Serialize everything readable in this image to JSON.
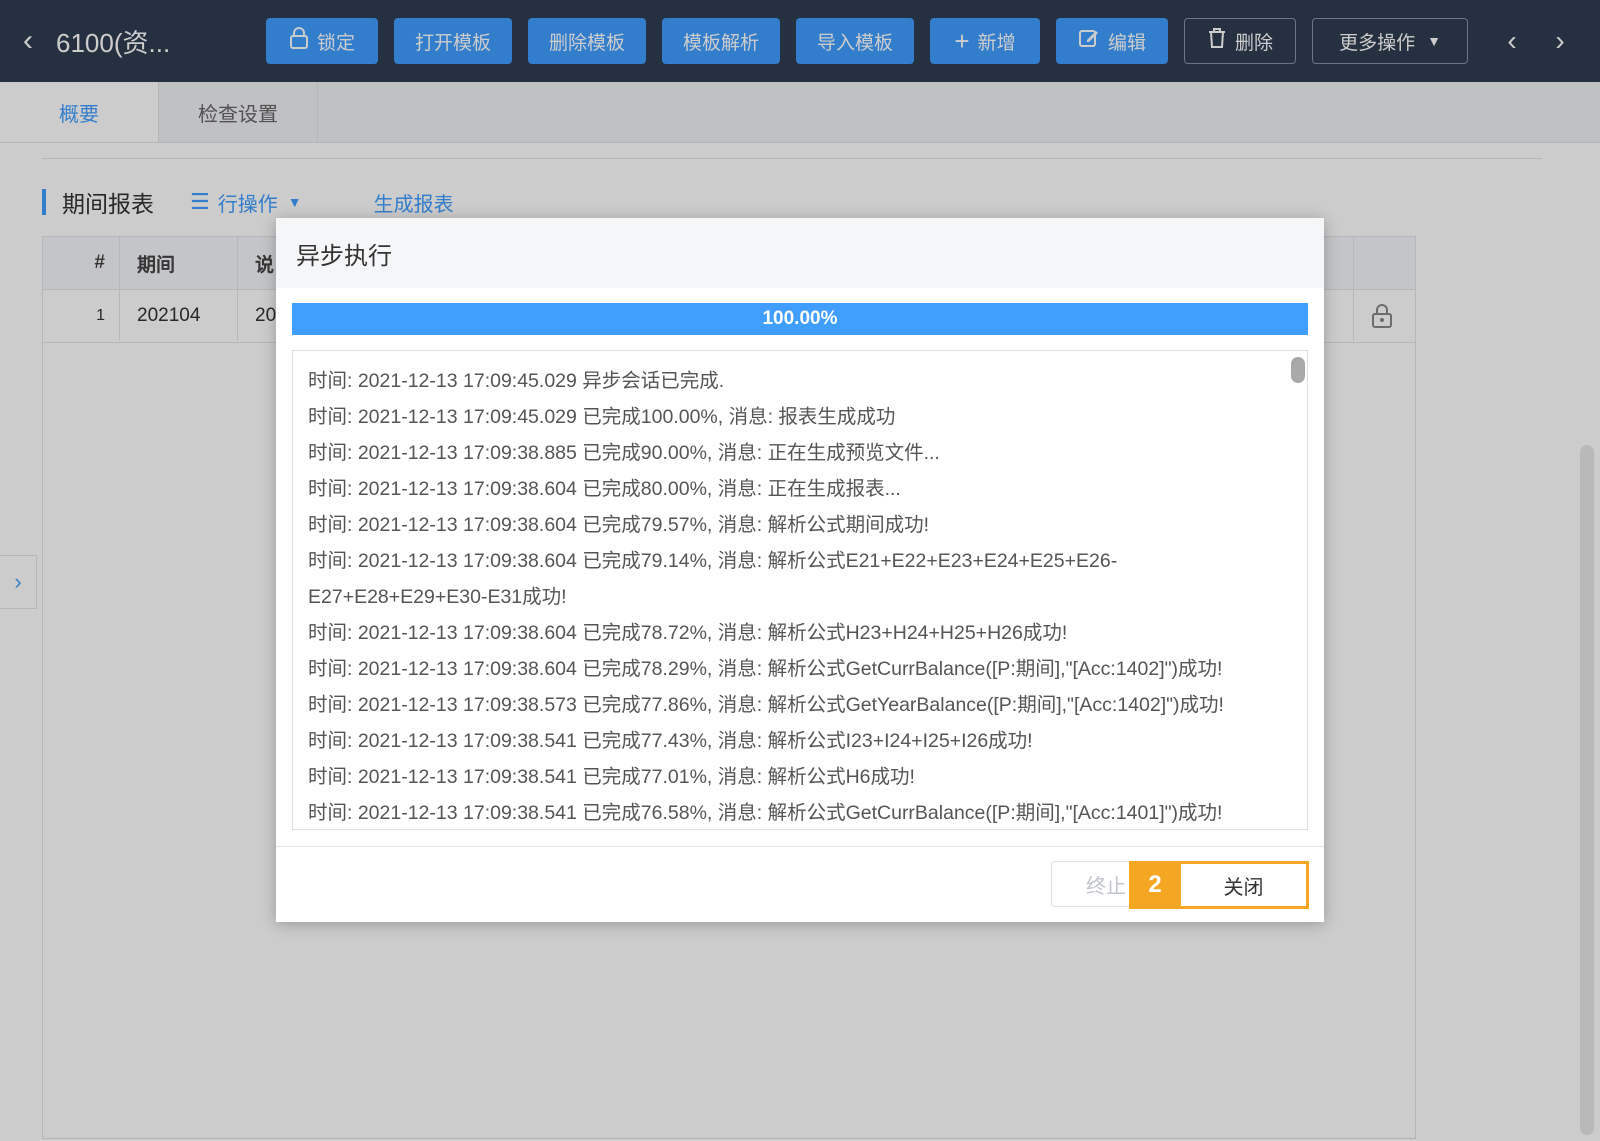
{
  "header": {
    "title": "6100(资...",
    "buttons": {
      "lock": "锁定",
      "open_template": "打开模板",
      "delete_template": "删除模板",
      "parse_template": "模板解析",
      "import_template": "导入模板",
      "add": "新增",
      "edit": "编辑",
      "delete": "删除",
      "more": "更多操作"
    },
    "icons": [
      "back-icon",
      "lock-icon",
      "plus-icon",
      "edit-icon",
      "trash-icon",
      "caret-down-icon",
      "prev-icon",
      "next-icon"
    ]
  },
  "tabs": [
    {
      "label": "概要",
      "active": true
    },
    {
      "label": "检查设置",
      "active": false
    }
  ],
  "section": {
    "title": "期间报表",
    "row_ops": "行操作",
    "generate": "生成报表"
  },
  "table": {
    "headers": {
      "index": "#",
      "period": "期间",
      "desc": "说"
    },
    "rows": [
      {
        "index": "1",
        "period": "202104",
        "desc": "20"
      }
    ]
  },
  "dialog": {
    "title": "异步执行",
    "progress_text": "100.00%",
    "progress": 1.0,
    "logs": [
      "时间: 2021-12-13 17:09:45.029 异步会话已完成.",
      "时间: 2021-12-13 17:09:45.029 已完成100.00%, 消息: 报表生成成功",
      "时间: 2021-12-13 17:09:38.885 已完成90.00%, 消息: 正在生成预览文件...",
      "时间: 2021-12-13 17:09:38.604 已完成80.00%, 消息: 正在生成报表...",
      "时间: 2021-12-13 17:09:38.604 已完成79.57%, 消息: 解析公式期间成功!",
      "时间: 2021-12-13 17:09:38.604 已完成79.14%, 消息: 解析公式E21+E22+E23+E24+E25+E26-",
      "E27+E28+E29+E30-E31成功!",
      "时间: 2021-12-13 17:09:38.604 已完成78.72%, 消息: 解析公式H23+H24+H25+H26成功!",
      "时间: 2021-12-13 17:09:38.604 已完成78.29%, 消息: 解析公式GetCurrBalance([P:期间],\"[Acc:1402]\")成功!",
      "时间: 2021-12-13 17:09:38.573 已完成77.86%, 消息: 解析公式GetYearBalance([P:期间],\"[Acc:1402]\")成功!",
      "时间: 2021-12-13 17:09:38.541 已完成77.43%, 消息: 解析公式I23+I24+I25+I26成功!",
      "时间: 2021-12-13 17:09:38.541 已完成77.01%, 消息: 解析公式H6成功!",
      "时间: 2021-12-13 17:09:38.541 已完成76.58%, 消息: 解析公式GetCurrBalance([P:期间],\"[Acc:1401]\")成功!"
    ],
    "btn_stop": "终止",
    "btn_close": "关闭",
    "callout": "2"
  },
  "colors": {
    "primary": "#409eff",
    "topbar": "#2f3e52",
    "callout": "#f5a623"
  }
}
